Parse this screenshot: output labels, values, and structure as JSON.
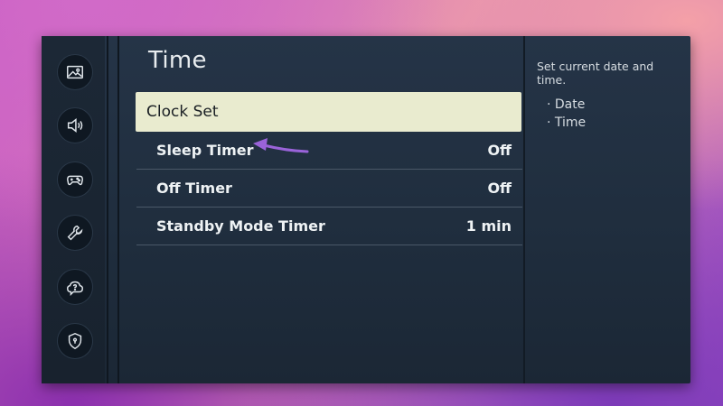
{
  "page": {
    "title": "Time"
  },
  "sidebar": {
    "items": [
      {
        "icon": "picture-icon"
      },
      {
        "icon": "sound-icon"
      },
      {
        "icon": "game-controller-icon"
      },
      {
        "icon": "wrench-icon"
      },
      {
        "icon": "support-chat-icon"
      },
      {
        "icon": "privacy-shield-icon"
      }
    ]
  },
  "menu": {
    "items": [
      {
        "label": "Clock Set",
        "value": "",
        "focused": true
      },
      {
        "label": "Sleep Timer",
        "value": "Off"
      },
      {
        "label": "Off Timer",
        "value": "Off"
      },
      {
        "label": "Standby Mode Timer",
        "value": "1 min"
      }
    ]
  },
  "help": {
    "title": "Set current date and time.",
    "items": [
      "Date",
      "Time"
    ]
  },
  "colors": {
    "focus_bg": "#e9ebcf",
    "annotation_arrow": "#9a63d9",
    "panel_bg": "#223143"
  }
}
